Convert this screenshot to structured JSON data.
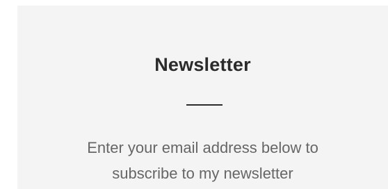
{
  "newsletter": {
    "title": "Newsletter",
    "description_line1": "Enter your email address below to",
    "description_line2": "subscribe to my newsletter"
  },
  "colors": {
    "panel_background": "#f4f4f4",
    "title_text": "#2b2b2b",
    "body_text": "#666666"
  }
}
